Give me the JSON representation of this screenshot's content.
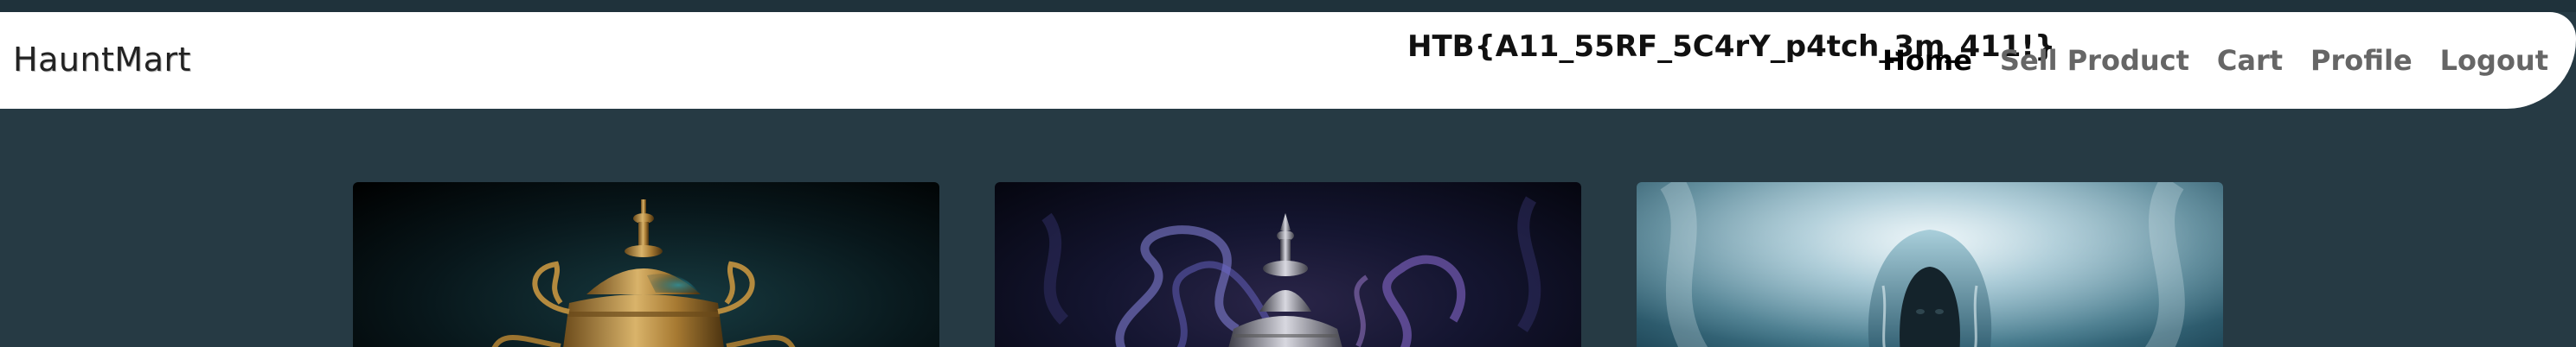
{
  "brand": "HauntMart",
  "flag_text": "HTB{A11_55RF_5C4rY_p4tch_3m_411!}",
  "nav": {
    "items": [
      {
        "label": "Home",
        "active": true
      },
      {
        "label": "Sell Product",
        "active": false
      },
      {
        "label": "Cart",
        "active": false
      },
      {
        "label": "Profile",
        "active": false
      },
      {
        "label": "Logout",
        "active": false
      }
    ]
  },
  "products": [
    {
      "image": "golden-lamp-image"
    },
    {
      "image": "silver-urn-smoke-image"
    },
    {
      "image": "hooded-ghost-image"
    }
  ],
  "colors": {
    "background": "#263a44",
    "navbar": "#ffffff",
    "nav_active": "#000000",
    "nav_inactive": "#666666"
  }
}
